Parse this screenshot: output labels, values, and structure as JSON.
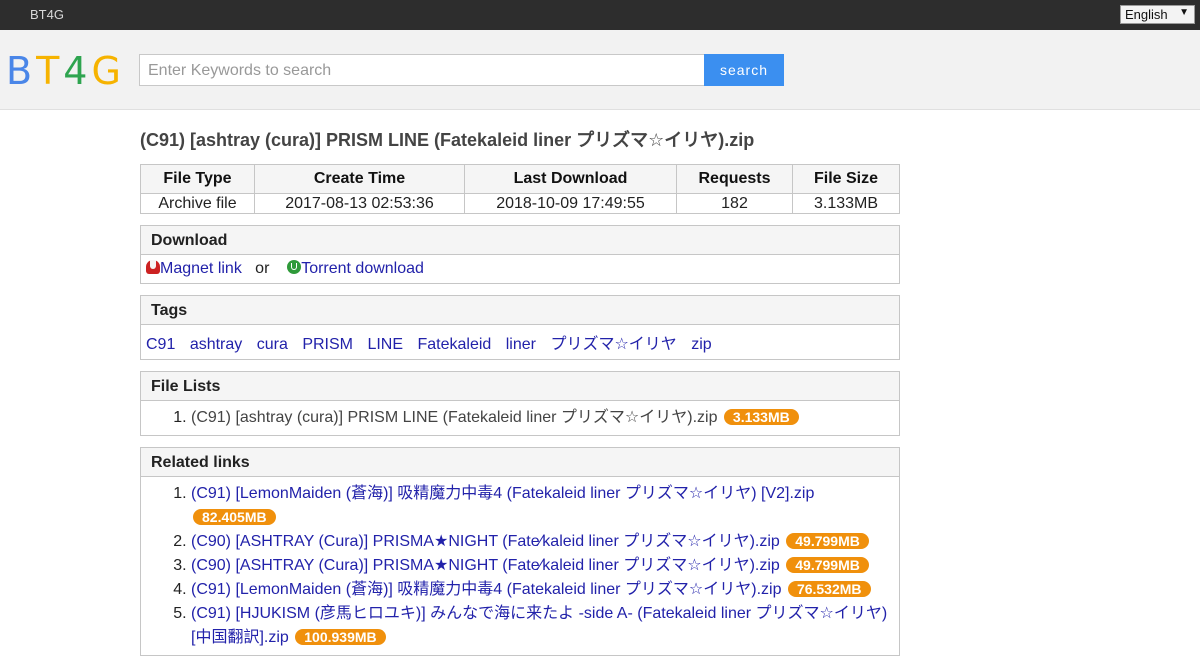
{
  "topbar": {
    "brand": "BT4G",
    "language": "English"
  },
  "logo": {
    "letters": [
      "B",
      "T",
      "4",
      "G"
    ],
    "colors": [
      "#4a86e8",
      "#f6b300",
      "#2ea44f",
      "#f6b300"
    ]
  },
  "search": {
    "placeholder": "Enter Keywords to search",
    "button_label": "search"
  },
  "title": "(C91) [ashtray (cura)] PRISM LINE (Fatekaleid liner プリズマ☆イリヤ).zip",
  "meta": {
    "headers": [
      "File Type",
      "Create Time",
      "Last Download",
      "Requests",
      "File Size"
    ],
    "values": [
      "Archive file",
      "2017-08-13 02:53:36",
      "2018-10-09 17:49:55",
      "182",
      "3.133MB"
    ]
  },
  "download": {
    "heading": "Download",
    "magnet_label": "Magnet link",
    "or_text": "or",
    "torrent_label": "Torrent download"
  },
  "tags": {
    "heading": "Tags",
    "items": [
      "C91",
      "ashtray",
      "cura",
      "PRISM",
      "LINE",
      "Fatekaleid",
      "liner",
      "プリズマ☆イリヤ",
      "zip"
    ]
  },
  "file_lists": {
    "heading": "File Lists",
    "items": [
      {
        "name": "(C91) [ashtray (cura)] PRISM LINE (Fatekaleid liner プリズマ☆イリヤ).zip",
        "size": "3.133MB"
      }
    ]
  },
  "related": {
    "heading": "Related links",
    "items": [
      {
        "name": "(C91) [LemonMaiden (蒼海)] 吸精魔力中毒4 (Fatekaleid liner プリズマ☆イリヤ) [V2].zip",
        "size": "82.405MB"
      },
      {
        "name": "(C90) [ASHTRAY (Cura)] PRISMA★NIGHT (Fate⁄kaleid liner プリズマ☆イリヤ).zip",
        "size": "49.799MB"
      },
      {
        "name": "(C90) [ASHTRAY (Cura)] PRISMA★NIGHT (Fate⁄kaleid liner プリズマ☆イリヤ).zip",
        "size": "49.799MB"
      },
      {
        "name": "(C91) [LemonMaiden (蒼海)] 吸精魔力中毒4 (Fatekaleid liner プリズマ☆イリヤ).zip",
        "size": "76.532MB"
      },
      {
        "name": "(C91) [HJUKISM (彦馬ヒロユキ)] みんなで海に来たよ -side A- (Fatekaleid liner プリズマ☆イリヤ) [中国翻訳].zip",
        "size": "100.939MB"
      }
    ]
  }
}
